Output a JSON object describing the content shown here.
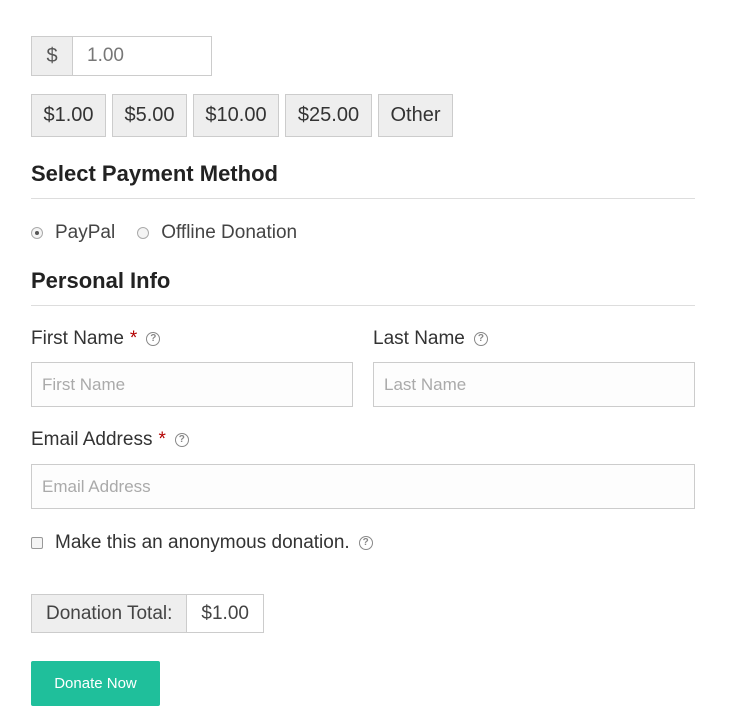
{
  "amount": {
    "currency_symbol": "$",
    "value": "1.00"
  },
  "levels": [
    "$1.00",
    "$5.00",
    "$10.00",
    "$25.00",
    "Other"
  ],
  "payment": {
    "title": "Select Payment Method",
    "options": [
      {
        "label": "PayPal",
        "checked": true
      },
      {
        "label": "Offline Donation",
        "checked": false
      }
    ]
  },
  "personal": {
    "title": "Personal Info",
    "first_name": {
      "label": "First Name",
      "required": "*",
      "placeholder": "First Name"
    },
    "last_name": {
      "label": "Last Name",
      "placeholder": "Last Name"
    },
    "email": {
      "label": "Email Address",
      "required": "*",
      "placeholder": "Email Address"
    }
  },
  "anonymous": {
    "label": "Make this an anonymous donation."
  },
  "total": {
    "label": "Donation Total:",
    "value": "$1.00"
  },
  "submit": {
    "label": "Donate Now"
  },
  "colors": {
    "accent": "#1fbf9b",
    "required": "#b30000"
  },
  "icons": {
    "help": "question-circle-icon"
  }
}
